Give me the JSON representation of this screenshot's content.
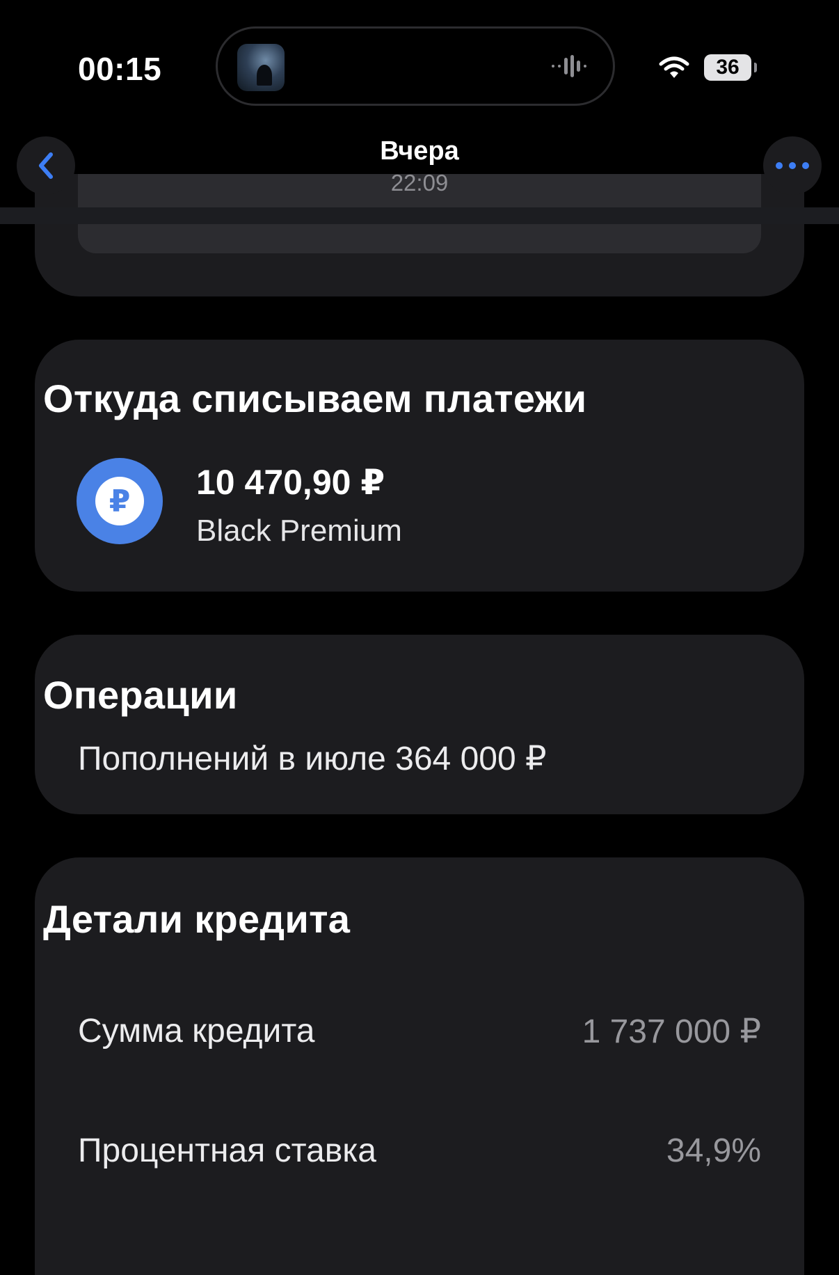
{
  "status_bar": {
    "time": "00:15",
    "battery": "36"
  },
  "header": {
    "title": "Вчера",
    "subtitle": "22:09"
  },
  "payment_source": {
    "title": "Откуда списываем платежи",
    "amount": "10 470,90 ₽",
    "account_name": "Black Premium",
    "icon_glyph": "₽"
  },
  "operations": {
    "title": "Операции",
    "summary": "Пополнений в июле 364 000 ₽"
  },
  "credit_details": {
    "title": "Детали кредита",
    "rows": [
      {
        "label": "Сумма кредита",
        "value": "1 737 000 ₽"
      },
      {
        "label": "Процентная ставка",
        "value": "34,9%"
      }
    ]
  },
  "colors": {
    "background": "#000000",
    "card": "#1c1c1f",
    "accent_blue": "#4a82e6",
    "secondary_text": "#98989d"
  }
}
